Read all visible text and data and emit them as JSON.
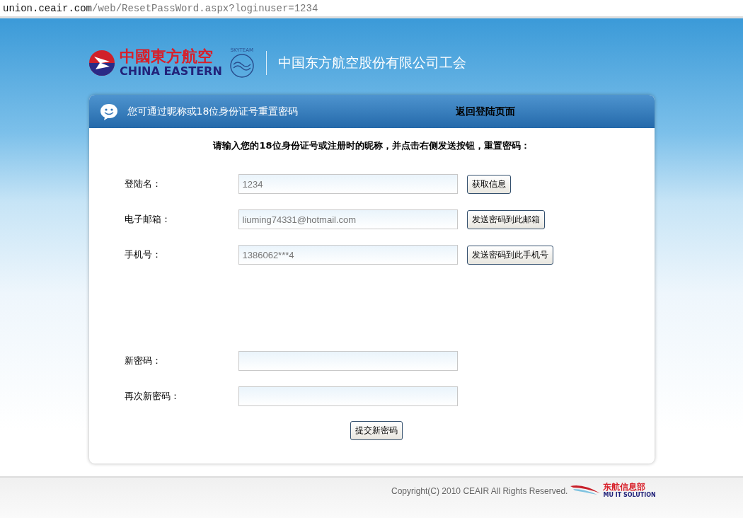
{
  "address_bar": {
    "host": "union.ceair.com",
    "path": "/web/ResetPassWord.aspx?loginuser=1234"
  },
  "header": {
    "logo_cn": "中國東方航空",
    "logo_en": "CHINA EASTERN",
    "alliance": "SKYTEAM",
    "org_name": "中国东方航空股份有限公司工会"
  },
  "panel": {
    "title": "您可通过昵称或18位身份证号重置密码",
    "back_link": "返回登陆页面",
    "instruction": "请输入您的18位身份证号或注册时的昵称，并点击右侧发送按钮，重置密码：",
    "rows": [
      {
        "label": "登陆名：",
        "value": "1234",
        "button": "获取信息"
      },
      {
        "label": "电子邮箱：",
        "value": "liuming74331@hotmail.com",
        "button": "发送密码到此邮箱"
      },
      {
        "label": "手机号：",
        "value": "1386062***4",
        "button": "发送密码到此手机号"
      }
    ],
    "password_rows": [
      {
        "label": "新密码："
      },
      {
        "label": "再次新密码："
      }
    ],
    "submit": "提交新密码"
  },
  "footer": {
    "copyright": "Copyright(C) 2010 CEAIR All Rights Reserved.",
    "logo_cn": "东航信息部",
    "logo_en": "MU IT SOLUTION"
  }
}
